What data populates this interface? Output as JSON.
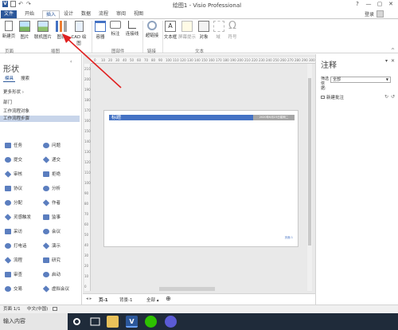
{
  "window": {
    "title": "绘图1 - Visio Professional",
    "controls": [
      "?",
      "—",
      "▢",
      "✕"
    ]
  },
  "tabs": [
    "文件",
    "开始",
    "插入",
    "设计",
    "数据",
    "流程",
    "审阅",
    "视图"
  ],
  "user": {
    "login": "登录"
  },
  "ribbon": {
    "buttons": [
      {
        "label": "新建页",
        "icon": "new-page-icon"
      },
      {
        "label": "图片",
        "icon": "picture-icon"
      },
      {
        "label": "联机图片",
        "icon": "online-picture-icon"
      },
      {
        "label": "图表",
        "icon": "chart-icon"
      },
      {
        "label": "CAD 绘图",
        "icon": "cad-drawing-icon"
      },
      {
        "label": "容器",
        "icon": "container-icon"
      },
      {
        "label": "标注",
        "icon": "callout-icon"
      },
      {
        "label": "连接线",
        "icon": "connector-icon"
      },
      {
        "label": "超链接",
        "icon": "hyperlink-icon"
      },
      {
        "label": "文本框",
        "icon": "textbox-icon"
      },
      {
        "label": "屏幕提示",
        "icon": "screentip-icon"
      },
      {
        "label": "对象",
        "icon": "object-icon"
      },
      {
        "label": "域",
        "icon": "field-icon"
      },
      {
        "label": "符号",
        "icon": "symbol-icon"
      }
    ],
    "groups": [
      "页面",
      "插图",
      "图部件",
      "链接",
      "文本"
    ]
  },
  "shapes_pane": {
    "title": "形状",
    "tabs": [
      "模具",
      "搜索"
    ],
    "stencils": [
      "更多形状 ›",
      "部门",
      "工作流程对象",
      "工作流程步骤"
    ],
    "shapes": [
      [
        "任务",
        "问题"
      ],
      [
        "提交",
        "递交"
      ],
      [
        "审核",
        "拒绝"
      ],
      [
        "协议",
        "分析"
      ],
      [
        "分配",
        "作者"
      ],
      [
        "灵感触发",
        "监事"
      ],
      [
        "采访",
        "会议"
      ],
      [
        "打电话",
        "演示"
      ],
      [
        "流程",
        "研究"
      ],
      [
        "审查",
        "启动"
      ],
      [
        "交易",
        "虚拟会议"
      ]
    ]
  },
  "canvas": {
    "page_title": "标题",
    "page_date": "2020年6月23日星期二",
    "page_footer": "页面 1",
    "ruler_top": [
      "0",
      "10",
      "20",
      "30",
      "40",
      "50",
      "60",
      "70",
      "80",
      "90",
      "100",
      "110",
      "120",
      "130",
      "140",
      "150",
      "160",
      "170",
      "180",
      "190",
      "200",
      "210",
      "220",
      "230",
      "240",
      "250",
      "260",
      "270",
      "280",
      "290",
      "300"
    ],
    "ruler_left": [
      "210",
      "200",
      "190",
      "180",
      "170",
      "160",
      "150",
      "140",
      "130",
      "120",
      "110",
      "100",
      "90",
      "80",
      "70",
      "60",
      "50",
      "40",
      "30",
      "20",
      "10",
      "0"
    ]
  },
  "page_tabs": {
    "nav": "◂ ▸",
    "tabs": [
      "页-1",
      "背景-1",
      "全部 ▴"
    ],
    "add": "⊕"
  },
  "comments_pane": {
    "title": "注释",
    "filter_label": "筛选依据:",
    "filter_value": "全部",
    "new_comment": "新建批注"
  },
  "status": {
    "page": "页面 1/1",
    "lang": "中文(中国)"
  },
  "taskbar": {
    "search_text": "输入内容",
    "colors": {
      "bg": "#1f2b3a"
    }
  }
}
